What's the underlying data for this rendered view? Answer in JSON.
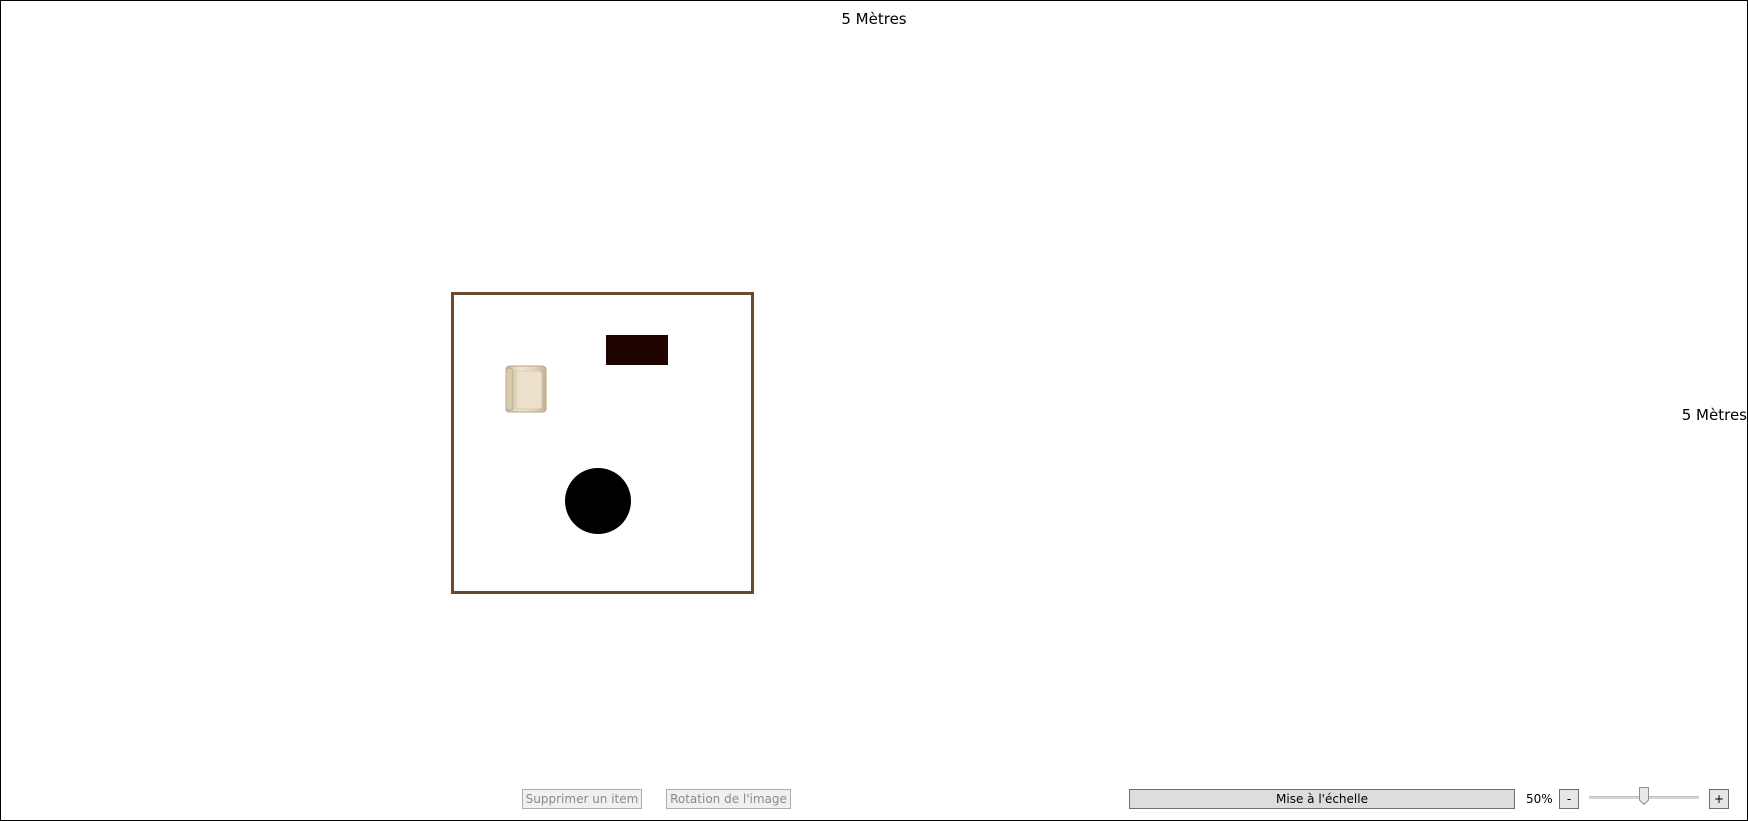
{
  "canvas": {
    "width_label": "5 Mètres",
    "height_label": "5 Mètres"
  },
  "room": {
    "border_color": "#6b4a2b",
    "items": [
      {
        "name": "armchair",
        "color": "#e8dcc4"
      },
      {
        "name": "rectangular-table",
        "color": "#200400"
      },
      {
        "name": "round-table",
        "color": "#000000"
      }
    ]
  },
  "toolbar": {
    "delete_label": "Supprimer un item",
    "rotate_label": "Rotation de l'image",
    "scale_label": "Mise à l'échelle",
    "zoom_value": "50%",
    "zoom_level": 0.5,
    "minus_label": "-",
    "plus_label": "+"
  }
}
